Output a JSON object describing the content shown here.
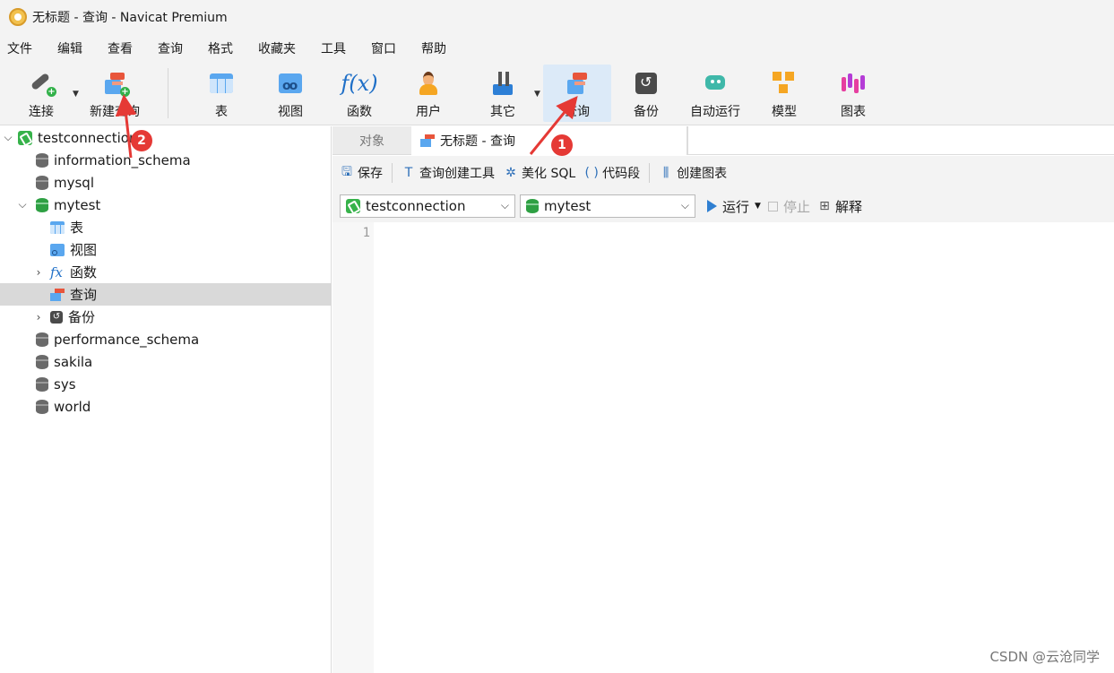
{
  "window": {
    "title": "无标题 - 查询 - Navicat Premium"
  },
  "menu": [
    "文件",
    "编辑",
    "查看",
    "查询",
    "格式",
    "收藏夹",
    "工具",
    "窗口",
    "帮助"
  ],
  "toolbar": {
    "connect": "连接",
    "new_query": "新建查询",
    "table": "表",
    "view": "视图",
    "function": "函数",
    "user": "用户",
    "other": "其它",
    "query": "查询",
    "backup": "备份",
    "automation": "自动运行",
    "model": "模型",
    "chart": "图表"
  },
  "navigator": {
    "connection": "testconnection",
    "databases": {
      "information_schema": "information_schema",
      "mysql": "mysql",
      "mytest": "mytest",
      "performance_schema": "performance_schema",
      "sakila": "sakila",
      "sys": "sys",
      "world": "world"
    },
    "mytest_children": {
      "tables": "表",
      "views": "视图",
      "functions": "函数",
      "queries": "查询",
      "backups": "备份"
    }
  },
  "tabs": {
    "objects": "对象",
    "current": "无标题 - 查询"
  },
  "query_toolbar": {
    "save": "保存",
    "query_builder": "查询创建工具",
    "beautify": "美化 SQL",
    "snippet": "代码段",
    "create_chart": "创建图表"
  },
  "selectors": {
    "connection": "testconnection",
    "database": "mytest",
    "run": "运行",
    "stop": "停止",
    "explain": "解释"
  },
  "editor": {
    "line_numbers": [
      "1"
    ]
  },
  "annotations": {
    "badge1": "1",
    "badge2": "2",
    "arrow_color": "#e53935"
  },
  "watermark": "CSDN @云沧同学"
}
